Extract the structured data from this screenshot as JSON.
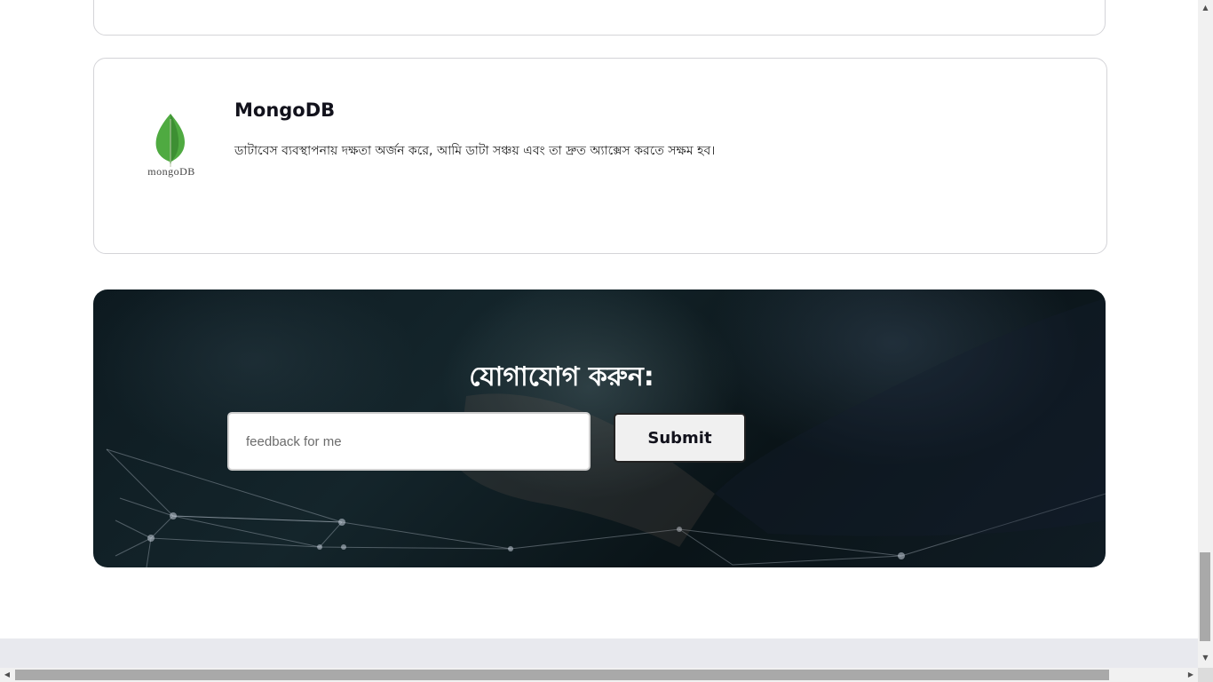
{
  "skill_card": {
    "logo_wordmark": "mongoDB",
    "title": "MongoDB",
    "description": "ডাটাবেস ব্যবস্থাপনায় দক্ষতা অর্জন করে, আমি ডাটা সঞ্চয় এবং তা দ্রুত অ্যাক্সেস করতে সক্ষম হব।"
  },
  "contact": {
    "title": "যোগাযোগ করুন:",
    "feedback_placeholder": "feedback for me",
    "feedback_value": "",
    "submit_label": "Submit"
  },
  "icons": {
    "logo": "mongodb-leaf-icon",
    "scroll_up": "triangle-up-icon",
    "scroll_down": "triangle-down-icon",
    "scroll_left": "triangle-left-icon",
    "scroll_right": "triangle-right-icon"
  },
  "colors": {
    "leaf_green": "#4faa41",
    "contact_bg": "#0d1a20",
    "submit_bg": "#f0f0f0",
    "footer": "#e8e9ee",
    "link_accent": "#1976d2"
  }
}
